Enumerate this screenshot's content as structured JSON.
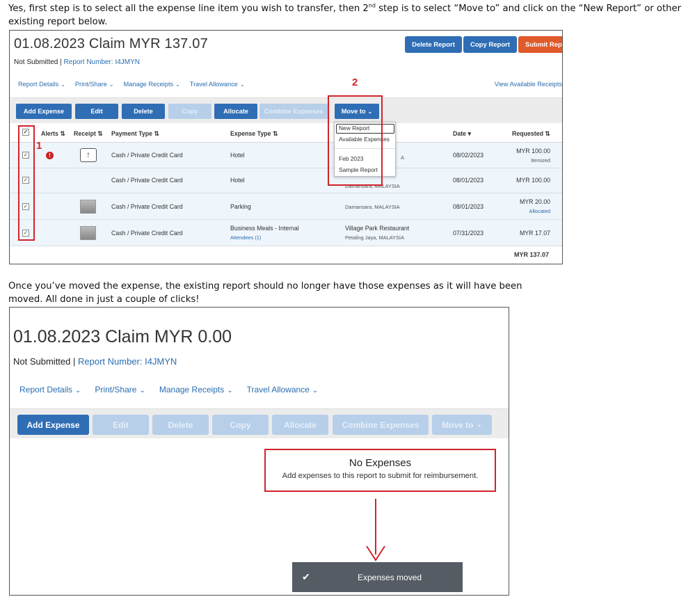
{
  "intro_text": {
    "part1": "Yes, first step is to select all the expense line item you wish to transfer, then 2",
    "sup": "nd",
    "part2": " step is to select “Move to” and click on the “New Report” or other existing report below."
  },
  "middle_text": "Once you’ve moved the expense, the existing report should no longer have those expenses as it will have been moved. All done in just a couple of clicks!",
  "colors": {
    "primary": "#2f6eb5",
    "disabled": "#b7cfe9",
    "submit": "#e05a2a",
    "annotation_red": "#d2232a",
    "link": "#2a6db0"
  },
  "shot1": {
    "title": "01.08.2023 Claim MYR 137.07",
    "status": "Not Submitted |",
    "report_number": "Report Number: I4JMYN",
    "top_buttons": [
      "Delete Report",
      "Copy Report",
      "Submit Repo"
    ],
    "tabs": [
      "Report Details",
      "Print/Share",
      "Manage Receipts",
      "Travel Allowance"
    ],
    "view_receipts": "View Available Receipts",
    "toolbar": [
      "Add Expense",
      "Edit",
      "Delete",
      "Copy",
      "Allocate",
      "Combine Expenses",
      "Move to"
    ],
    "headers": {
      "alerts": "Alerts ⇅",
      "receipt": "Receipt ⇅",
      "payment": "Payment Type ⇅",
      "expense": "Expense Type ⇅",
      "date": "Date ▾",
      "requested": "Requested ⇅"
    },
    "rows": [
      {
        "payment": "Cash / Private Credit Card",
        "expense": "Hotel",
        "expense_sub": "",
        "vendor": "",
        "vendor_sub": "A",
        "date": "08/02/2023",
        "amount": "MYR 100.00",
        "amount_sub": "Itemized"
      },
      {
        "payment": "Cash / Private Credit Card",
        "expense": "Hotel",
        "expense_sub": "",
        "vendor": "",
        "vendor_sub": "Damansara, MALAYSIA",
        "date": "08/01/2023",
        "amount": "MYR 100.00",
        "amount_sub": ""
      },
      {
        "payment": "Cash / Private Credit Card",
        "expense": "Parking",
        "expense_sub": "",
        "vendor": "",
        "vendor_sub": "Damansara, MALAYSIA",
        "date": "08/01/2023",
        "amount": "MYR 20.00",
        "amount_sub": "Allocated"
      },
      {
        "payment": "Cash / Private Credit Card",
        "expense": "Business Meals - Internal",
        "expense_sub": "Attendees (1)",
        "vendor": "Village Park Restaurant",
        "vendor_sub": "Petaling Jaya, MALAYSIA",
        "date": "07/31/2023",
        "amount": "MYR 17.07",
        "amount_sub": ""
      }
    ],
    "total": "MYR 137.07",
    "dropdown": [
      "New Report",
      "Available Expenses",
      "Feb 2023",
      "Sample Report"
    ],
    "annotations": [
      "1",
      "2"
    ],
    "checkmark": "✓"
  },
  "shot2": {
    "title": "01.08.2023 Claim MYR 0.00",
    "status": "Not Submitted |",
    "report_number": "Report Number: I4JMYN",
    "tabs": [
      "Report Details",
      "Print/Share",
      "Manage Receipts",
      "Travel Allowance"
    ],
    "toolbar": [
      "Add Expense",
      "Edit",
      "Delete",
      "Copy",
      "Allocate",
      "Combine Expenses",
      "Move to"
    ],
    "no_expenses_title": "No Expenses",
    "no_expenses_desc": "Add expenses to this report to submit for reimbursement.",
    "toast": "Expenses moved",
    "toast_icon": "✔"
  },
  "chevron": "⌄"
}
